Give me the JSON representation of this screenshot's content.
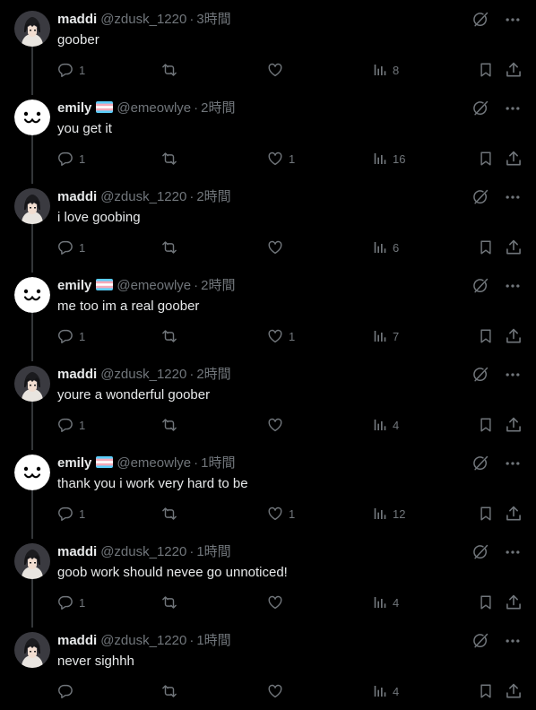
{
  "colors": {
    "background": "#000000",
    "text_primary": "#e7e9ea",
    "text_secondary": "#71767b",
    "thread_line": "#333639"
  },
  "users": {
    "maddi": {
      "display_name": "maddi",
      "handle": "@zdusk_1220",
      "avatar": "anime-girl-avatar",
      "flag": false
    },
    "emily": {
      "display_name": "emily",
      "handle": "@emeowlye",
      "avatar": "cat-face-avatar",
      "flag": true
    }
  },
  "separator": "·",
  "icons": {
    "grok": "grok-icon",
    "more": "more-icon",
    "reply": "reply-icon",
    "retweet": "retweet-icon",
    "like": "like-icon",
    "views": "views-icon",
    "bookmark": "bookmark-icon",
    "share": "share-icon",
    "flag": "trans-flag-emoji"
  },
  "tweets": [
    {
      "user": "maddi",
      "time": "3時間",
      "text": "goober",
      "replies": "1",
      "retweets": "",
      "likes": "",
      "views": "8"
    },
    {
      "user": "emily",
      "time": "2時間",
      "text": "you get it",
      "replies": "1",
      "retweets": "",
      "likes": "1",
      "views": "16"
    },
    {
      "user": "maddi",
      "time": "2時間",
      "text": "i love goobing",
      "replies": "1",
      "retweets": "",
      "likes": "",
      "views": "6"
    },
    {
      "user": "emily",
      "time": "2時間",
      "text": "me too im a real goober",
      "replies": "1",
      "retweets": "",
      "likes": "1",
      "views": "7"
    },
    {
      "user": "maddi",
      "time": "2時間",
      "text": "youre a wonderful goober",
      "replies": "1",
      "retweets": "",
      "likes": "",
      "views": "4"
    },
    {
      "user": "emily",
      "time": "1時間",
      "text": "thank you i work very hard to be",
      "replies": "1",
      "retweets": "",
      "likes": "1",
      "views": "12"
    },
    {
      "user": "maddi",
      "time": "1時間",
      "text": "goob work should nevee go unnoticed!",
      "replies": "1",
      "retweets": "",
      "likes": "",
      "views": "4"
    },
    {
      "user": "maddi",
      "time": "1時間",
      "text": "never sighhh",
      "replies": "",
      "retweets": "",
      "likes": "",
      "views": "4"
    }
  ]
}
